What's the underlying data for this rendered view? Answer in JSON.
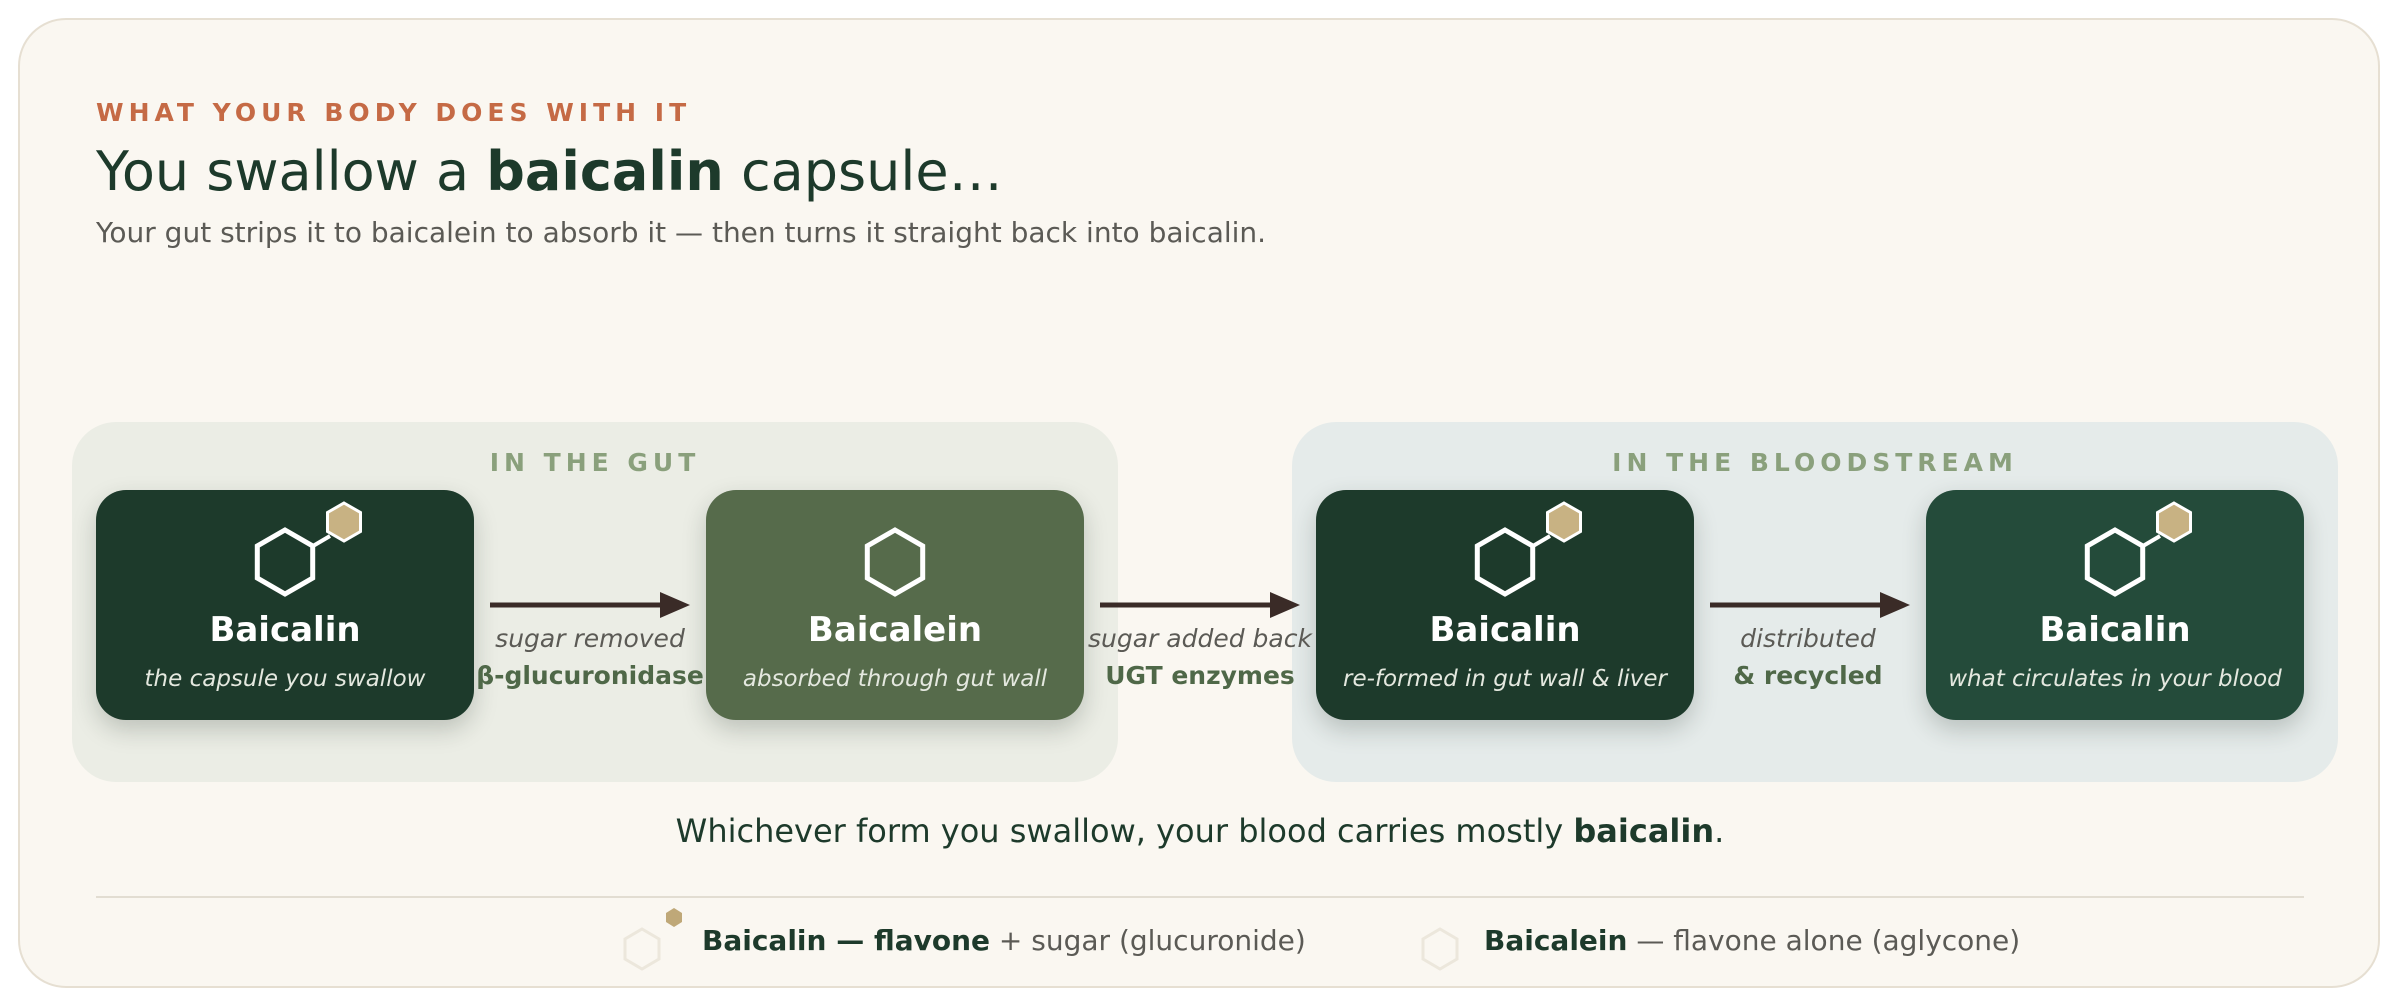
{
  "header": {
    "eyebrow": "WHAT YOUR BODY DOES WITH IT",
    "title_pre": "You swallow a ",
    "title_bold": "baicalin",
    "title_post": " capsule…",
    "subtitle": "Your gut strips it to baicalein to absorb it — then turns it straight back into baicalin."
  },
  "stages": {
    "gut": "IN THE GUT",
    "blood": "IN THE BLOODSTREAM"
  },
  "nodes": [
    {
      "name": "Baicalin",
      "sub": "the capsule you swallow",
      "color": "#1d3a2b",
      "has_sugar": true
    },
    {
      "name": "Baicalein",
      "sub": "absorbed through gut wall",
      "color": "#566b4b",
      "has_sugar": false
    },
    {
      "name": "Baicalin",
      "sub": "re-formed in gut wall & liver",
      "color": "#1d3a2b",
      "has_sugar": true
    },
    {
      "name": "Baicalin",
      "sub": "what circulates in your blood",
      "color": "#244b3a",
      "has_sugar": true
    }
  ],
  "steps": [
    {
      "top": "sugar removed",
      "bottom": "β-glucuronidase"
    },
    {
      "top": "sugar added back",
      "bottom": "UGT enzymes"
    },
    {
      "top": "distributed",
      "bottom": "& recycled"
    }
  ],
  "conclusion": {
    "pre": "Whichever form you swallow, your blood carries mostly ",
    "bold": "baicalin",
    "post": "."
  },
  "legend": [
    {
      "bold": "Baicalin — flavone",
      "rest": " + sugar (glucuronide)",
      "icon": "hexagon-with-sugar-icon"
    },
    {
      "bold": "Baicalein",
      "rest": " — flavone alone (aglycone)",
      "icon": "hexagon-icon"
    }
  ],
  "colors": {
    "accent": "#c56a45",
    "dark_green": "#1d3a2b",
    "olive": "#566b4b",
    "sugar": "#c8b283",
    "stage_label": "#8aa07c",
    "arrow": "#3a2b27"
  }
}
